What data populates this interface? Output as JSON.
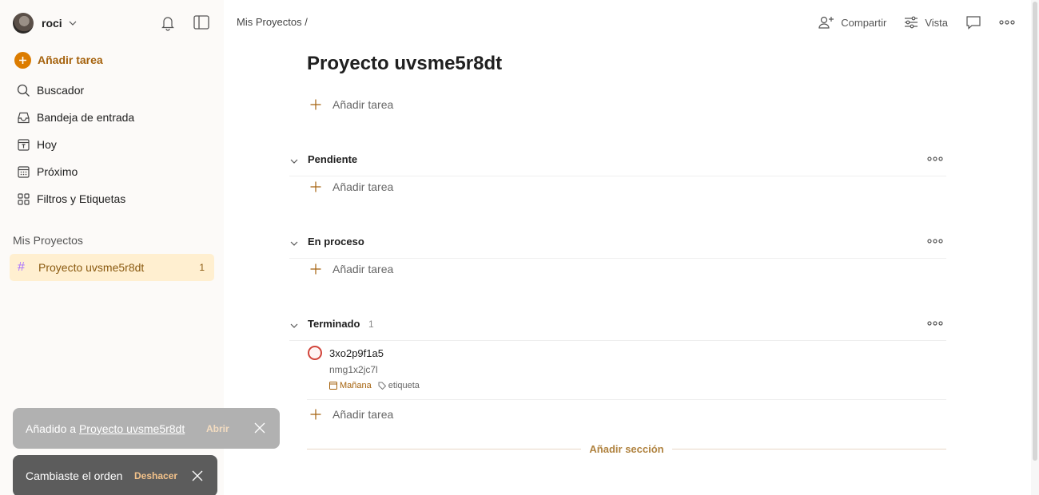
{
  "sidebar": {
    "user_name": "roci",
    "add_task": "Añadir tarea",
    "items": [
      {
        "icon": "search-icon",
        "label": "Buscador"
      },
      {
        "icon": "inbox-icon",
        "label": "Bandeja de entrada"
      },
      {
        "icon": "calendar-today-icon",
        "label": "Hoy"
      },
      {
        "icon": "calendar-upcoming-icon",
        "label": "Próximo"
      },
      {
        "icon": "filters-labels-icon",
        "label": "Filtros y Etiquetas"
      }
    ],
    "projects_heading": "Mis Proyectos",
    "project": {
      "name": "Proyecto uvsme5r8dt",
      "count": "1"
    }
  },
  "header": {
    "breadcrumb": "Mis Proyectos /",
    "share": "Compartir",
    "view": "Vista"
  },
  "main": {
    "title": "Proyecto uvsme5r8dt",
    "add_task": "Añadir tarea",
    "sections": [
      {
        "name": "Pendiente",
        "count": ""
      },
      {
        "name": "En proceso",
        "count": ""
      },
      {
        "name": "Terminado",
        "count": "1"
      }
    ],
    "task": {
      "title": "3xo2p9f1a5",
      "description": "nmg1x2jc7l",
      "due": "Mañana",
      "label": "etiqueta"
    },
    "add_section": "Añadir sección"
  },
  "toasts": {
    "added_prefix": "Añadido a",
    "added_link": "Proyecto uvsme5r8dt",
    "open": "Abrir",
    "reorder": "Cambiaste el orden",
    "undo": "Deshacer"
  },
  "colors": {
    "accent": "#dc7c00",
    "sidebar_bg": "#fcfaf8",
    "project_active_bg": "#ffefd0",
    "priority_red": "#d1453b"
  }
}
